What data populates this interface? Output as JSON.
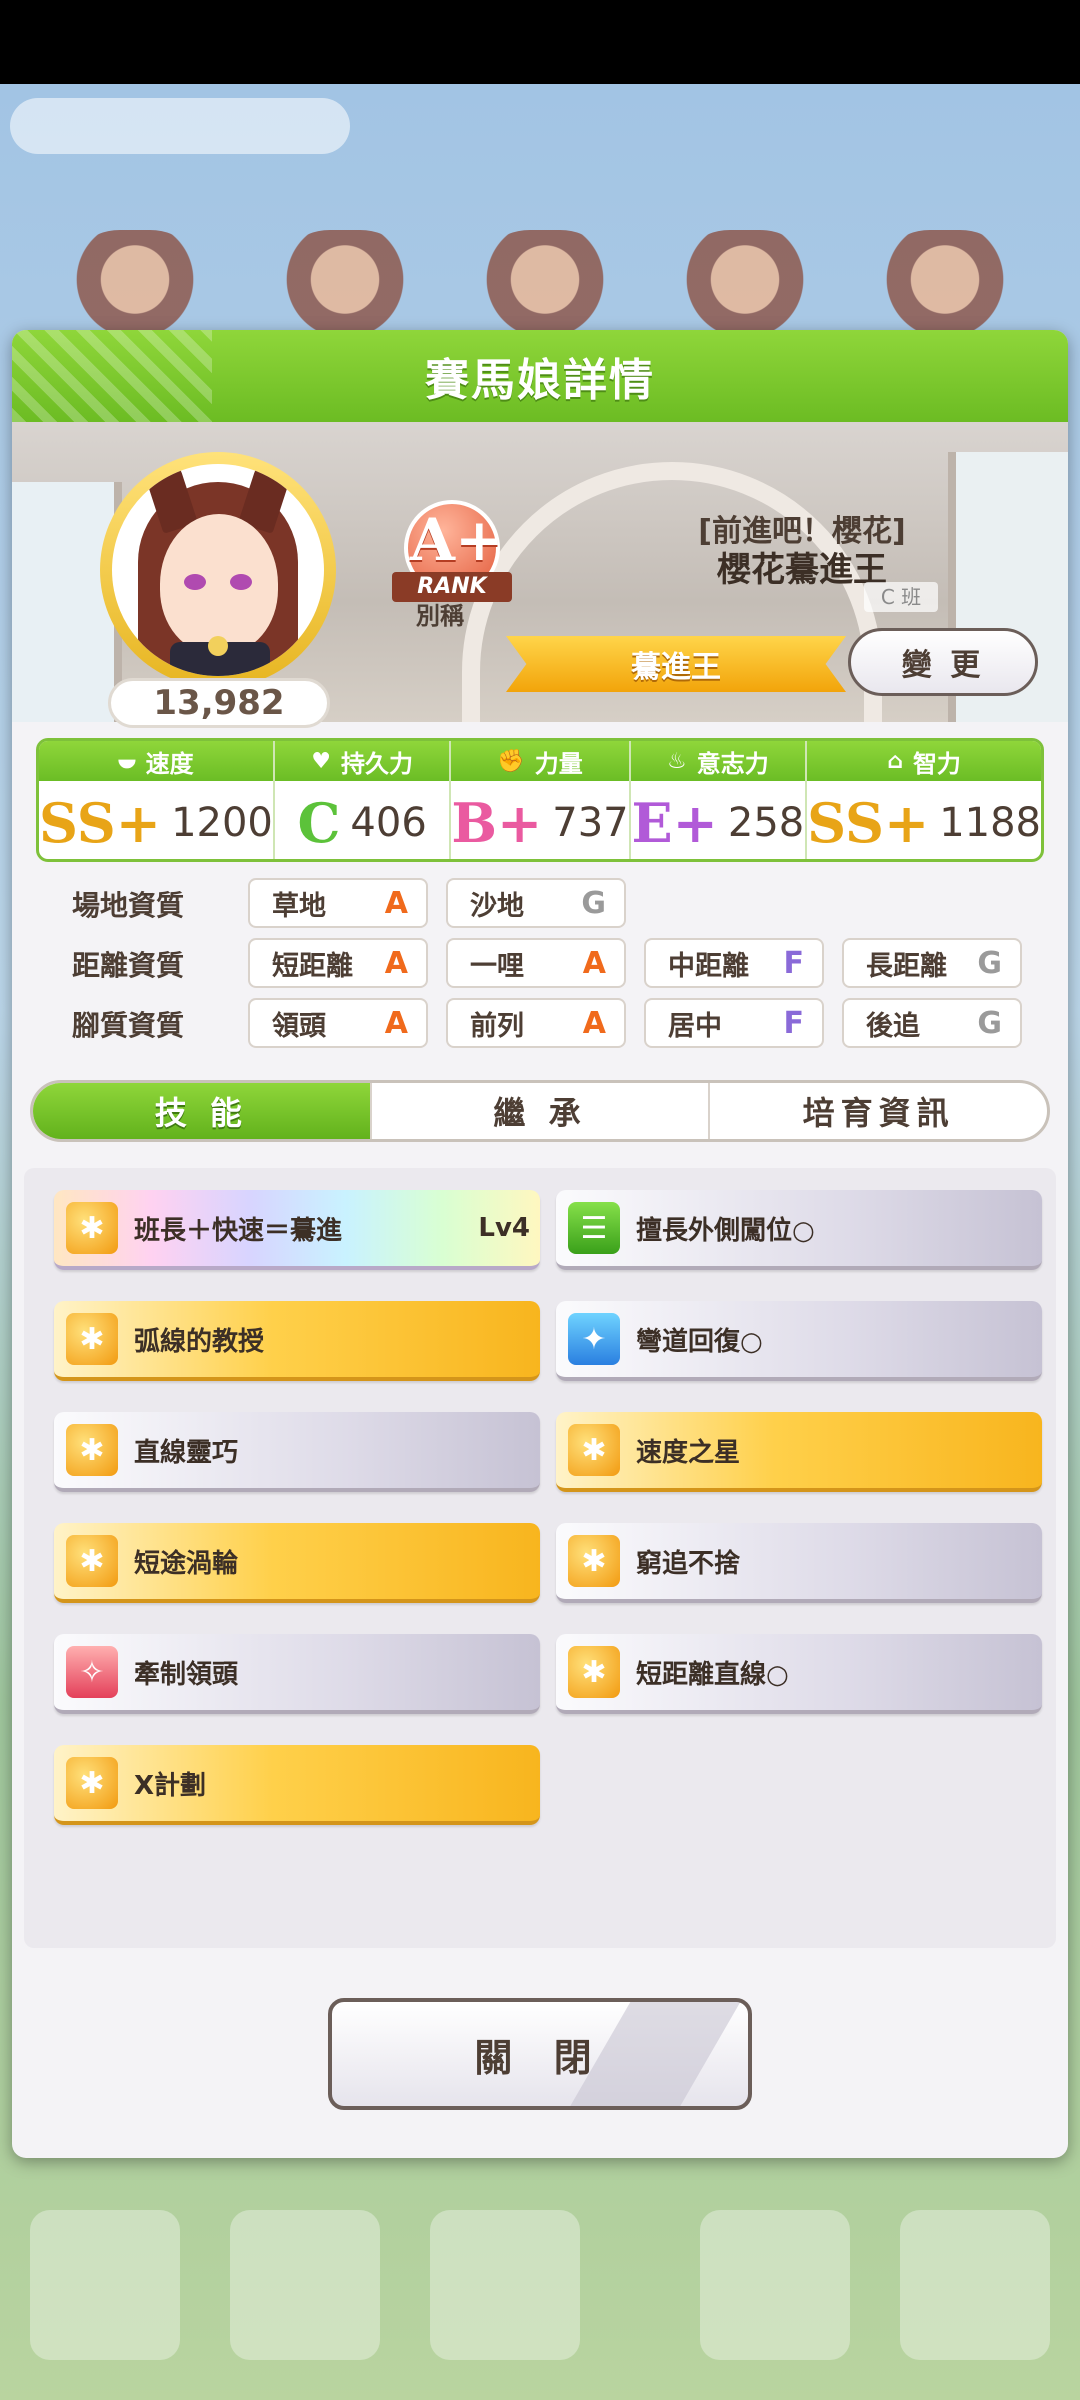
{
  "dialog": {
    "title": "賽馬娘詳情"
  },
  "profile": {
    "score": "13,982",
    "rank": {
      "letter": "A+",
      "label": "RANK"
    },
    "rank_caption": "別稱",
    "epithet": "[前進吧！櫻花]",
    "name": "櫻花驀進王",
    "class": "C 班",
    "title": "驀進王",
    "change_button": "變 更"
  },
  "stats": [
    {
      "name": "速度",
      "icon": "shoe-icon",
      "grade": "SS+",
      "value": "1200",
      "color": "#e8a417"
    },
    {
      "name": "持久力",
      "icon": "heart-icon",
      "grade": "C",
      "value": "406",
      "color": "#5cc23a"
    },
    {
      "name": "力量",
      "icon": "muscle-icon",
      "grade": "B+",
      "value": "737",
      "color": "#ea5aa0"
    },
    {
      "name": "意志力",
      "icon": "flame-icon",
      "grade": "E+",
      "value": "258",
      "color": "#b15ad8"
    },
    {
      "name": "智力",
      "icon": "graduation-cap-icon",
      "grade": "SS+",
      "value": "1188",
      "color": "#e8a417"
    }
  ],
  "aptitudes": [
    {
      "label": "場地資質",
      "items": [
        {
          "name": "草地",
          "grade": "A"
        },
        {
          "name": "沙地",
          "grade": "G"
        }
      ]
    },
    {
      "label": "距離資質",
      "items": [
        {
          "name": "短距離",
          "grade": "A"
        },
        {
          "name": "一哩",
          "grade": "A"
        },
        {
          "name": "中距離",
          "grade": "F"
        },
        {
          "name": "長距離",
          "grade": "G"
        }
      ]
    },
    {
      "label": "腳質資質",
      "items": [
        {
          "name": "領頭",
          "grade": "A"
        },
        {
          "name": "前列",
          "grade": "A"
        },
        {
          "name": "居中",
          "grade": "F"
        },
        {
          "name": "後追",
          "grade": "G"
        }
      ]
    }
  ],
  "grade_colors": {
    "A": "#f06a1c",
    "F": "#8a6ad8",
    "G": "#9a9a9a"
  },
  "tabs": [
    {
      "label": "技 能",
      "active": true
    },
    {
      "label": "繼 承",
      "active": false
    },
    {
      "label": "培育資訊",
      "active": false
    }
  ],
  "skills": [
    {
      "name": "班長＋快速＝驀進",
      "level": "Lv4",
      "style": "rainbow",
      "icon": "speed-icon"
    },
    {
      "name": "擅長外側闖位○",
      "level": "",
      "style": "normal",
      "icon": "strategy-icon"
    },
    {
      "name": "弧線的教授",
      "level": "",
      "style": "gold",
      "icon": "speed-icon"
    },
    {
      "name": "彎道回復○",
      "level": "",
      "style": "normal",
      "icon": "recovery-icon"
    },
    {
      "name": "直線靈巧",
      "level": "",
      "style": "normal",
      "icon": "speed-icon"
    },
    {
      "name": "速度之星",
      "level": "",
      "style": "gold",
      "icon": "speed-icon"
    },
    {
      "name": "短途渦輪",
      "level": "",
      "style": "gold",
      "icon": "speed-icon"
    },
    {
      "name": "窮追不捨",
      "level": "",
      "style": "normal",
      "icon": "speed-icon"
    },
    {
      "name": "牽制領頭",
      "level": "",
      "style": "normal",
      "icon": "debuff-icon"
    },
    {
      "name": "短距離直線○",
      "level": "",
      "style": "normal",
      "icon": "speed-icon"
    },
    {
      "name": "X計劃",
      "level": "",
      "style": "gold",
      "icon": "speed-icon"
    }
  ],
  "close_button": "關 閉"
}
